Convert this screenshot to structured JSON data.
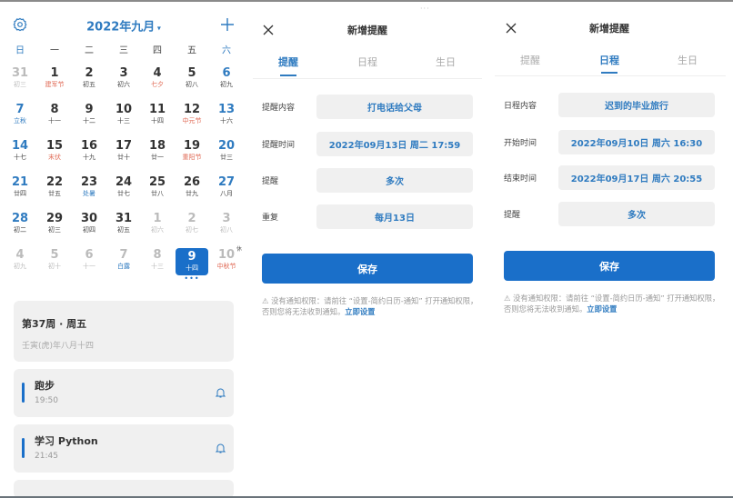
{
  "calendar": {
    "month_title": "2022年九月",
    "weekdays": [
      "日",
      "一",
      "二",
      "三",
      "四",
      "五",
      "六"
    ],
    "weeks": [
      [
        {
          "n": "31",
          "l": "初三",
          "dim": true
        },
        {
          "n": "1",
          "l": "建军节",
          "c": "red"
        },
        {
          "n": "2",
          "l": "初五"
        },
        {
          "n": "3",
          "l": "初六"
        },
        {
          "n": "4",
          "l": "七夕",
          "c": "red"
        },
        {
          "n": "5",
          "l": "初八"
        },
        {
          "n": "6",
          "l": "初九"
        }
      ],
      [
        {
          "n": "7",
          "l": "立秋",
          "c": "blue"
        },
        {
          "n": "8",
          "l": "十一"
        },
        {
          "n": "9",
          "l": "十二"
        },
        {
          "n": "10",
          "l": "十三"
        },
        {
          "n": "11",
          "l": "十四"
        },
        {
          "n": "12",
          "l": "中元节",
          "c": "red"
        },
        {
          "n": "13",
          "l": "十六"
        }
      ],
      [
        {
          "n": "14",
          "l": "十七"
        },
        {
          "n": "15",
          "l": "末伏",
          "c": "red"
        },
        {
          "n": "16",
          "l": "十九"
        },
        {
          "n": "17",
          "l": "廿十"
        },
        {
          "n": "18",
          "l": "廿一"
        },
        {
          "n": "19",
          "l": "重阳节",
          "c": "red"
        },
        {
          "n": "20",
          "l": "廿三"
        }
      ],
      [
        {
          "n": "21",
          "l": "廿四"
        },
        {
          "n": "22",
          "l": "廿五"
        },
        {
          "n": "23",
          "l": "处暑",
          "c": "blue"
        },
        {
          "n": "24",
          "l": "廿七"
        },
        {
          "n": "25",
          "l": "廿八"
        },
        {
          "n": "26",
          "l": "廿九"
        },
        {
          "n": "27",
          "l": "八月"
        }
      ],
      [
        {
          "n": "28",
          "l": "初二"
        },
        {
          "n": "29",
          "l": "初三"
        },
        {
          "n": "30",
          "l": "初四"
        },
        {
          "n": "31",
          "l": "初五"
        },
        {
          "n": "1",
          "l": "初六",
          "dim": true
        },
        {
          "n": "2",
          "l": "初七",
          "dim": true
        },
        {
          "n": "3",
          "l": "初八",
          "dim": true
        }
      ],
      [
        {
          "n": "4",
          "l": "初九",
          "dim": true
        },
        {
          "n": "5",
          "l": "初十",
          "dim": true
        },
        {
          "n": "6",
          "l": "十一",
          "dim": true
        },
        {
          "n": "7",
          "l": "白露",
          "dim": true,
          "c": "blue"
        },
        {
          "n": "8",
          "l": "十三",
          "dim": true
        },
        {
          "n": "9",
          "l": "十四",
          "selected": true
        },
        {
          "n": "10",
          "l": "中秋节",
          "dim": true,
          "c": "red",
          "badge": "休"
        }
      ]
    ],
    "selected_dots": "•••",
    "info": {
      "week": "第37周 · 周五",
      "lunar": "壬寅(虎)年八月十四"
    },
    "events": [
      {
        "title": "跑步",
        "time": "19:50"
      },
      {
        "title": "学习 Python",
        "time": "21:45"
      }
    ],
    "accent": "#1a6fc9"
  },
  "reminder_form": {
    "header": "新增提醒",
    "tabs": [
      "提醒",
      "日程",
      "生日"
    ],
    "active_tab": "提醒",
    "rows": [
      {
        "label": "提醒内容",
        "value": "打电话给父母"
      },
      {
        "label": "提醒时间",
        "value": "2022年09月13日 周二 17:59"
      },
      {
        "label": "提醒",
        "value": "多次"
      },
      {
        "label": "重复",
        "value": "每月13日"
      }
    ],
    "save": "保存",
    "notice": "⚠ 没有通知权限：请前往 “设置-简约日历-通知” 打开通知权限，否则您将无法收到通知。",
    "notice_link": "立即设置"
  },
  "schedule_form": {
    "header": "新增提醒",
    "tabs": [
      "提醒",
      "日程",
      "生日"
    ],
    "active_tab": "日程",
    "rows": [
      {
        "label": "日程内容",
        "value": "迟到的毕业旅行"
      },
      {
        "label": "开始时间",
        "value": "2022年09月10日 周六 16:30"
      },
      {
        "label": "结束时间",
        "value": "2022年09月17日 周六 20:55"
      },
      {
        "label": "提醒",
        "value": "多次"
      }
    ],
    "save": "保存",
    "notice": "⚠ 没有通知权限：请前往 “设置-简约日历-通知” 打开通知权限，否则您将无法收到通知。",
    "notice_link": "立即设置"
  }
}
